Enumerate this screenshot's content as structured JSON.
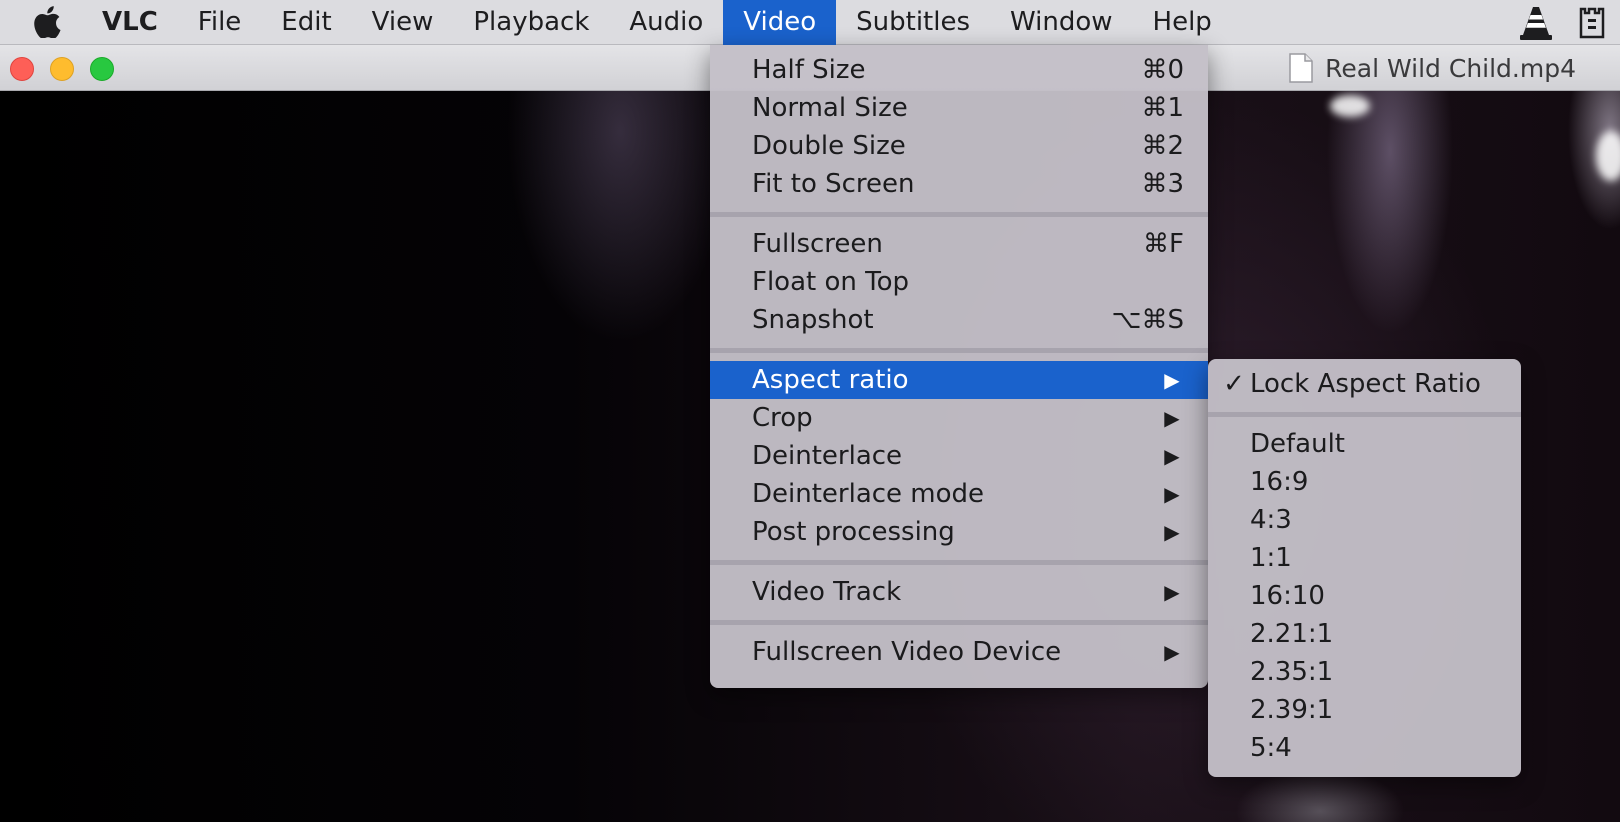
{
  "menubar": {
    "app_name": "VLC",
    "items": [
      "File",
      "Edit",
      "View",
      "Playback",
      "Audio",
      "Video",
      "Subtitles",
      "Window",
      "Help"
    ],
    "active_item": "Video"
  },
  "window": {
    "title": "Real Wild Child.mp4"
  },
  "video_menu": {
    "group1": [
      {
        "label": "Half Size",
        "shortcut": "⌘0"
      },
      {
        "label": "Normal Size",
        "shortcut": "⌘1"
      },
      {
        "label": "Double Size",
        "shortcut": "⌘2"
      },
      {
        "label": "Fit to Screen",
        "shortcut": "⌘3"
      }
    ],
    "group2": [
      {
        "label": "Fullscreen",
        "shortcut": "⌘F"
      },
      {
        "label": "Float on Top",
        "shortcut": ""
      },
      {
        "label": "Snapshot",
        "shortcut": "⌥⌘S"
      }
    ],
    "group3": [
      {
        "label": "Aspect ratio",
        "highlighted": true
      },
      {
        "label": "Crop"
      },
      {
        "label": "Deinterlace"
      },
      {
        "label": "Deinterlace mode"
      },
      {
        "label": "Post processing"
      }
    ],
    "group4": [
      {
        "label": "Video Track"
      }
    ],
    "group5": [
      {
        "label": "Fullscreen Video Device"
      }
    ],
    "submenu_arrow": "▶"
  },
  "aspect_menu": {
    "lock": {
      "label": "Lock Aspect Ratio",
      "checked": true,
      "check_glyph": "✓"
    },
    "options": [
      "Default",
      "16:9",
      "4:3",
      "1:1",
      "16:10",
      "2.21:1",
      "2.35:1",
      "2.39:1",
      "5:4"
    ]
  },
  "colors": {
    "menubar_bg": "#dcdce0",
    "highlight": "#1a62cc",
    "menu_bg": "#c4c0c8"
  }
}
